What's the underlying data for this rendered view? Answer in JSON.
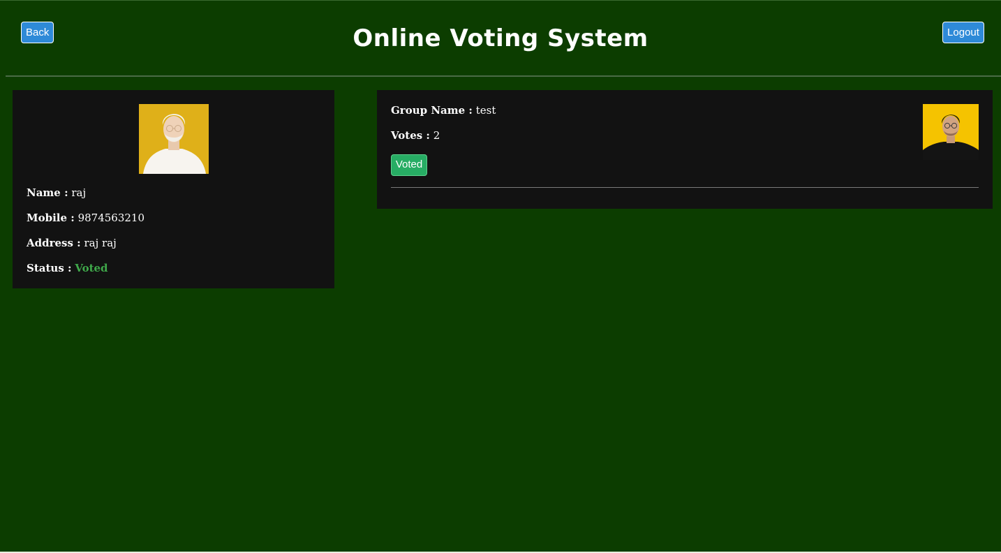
{
  "header": {
    "title": "Online Voting System",
    "back_label": "Back",
    "logout_label": "Logout"
  },
  "profile": {
    "name_label": "Name :",
    "name": "raj",
    "mobile_label": "Mobile :",
    "mobile": "9874563210",
    "address_label": "Address :",
    "address": "raj raj",
    "status_label": "Status :",
    "status": "Voted"
  },
  "groups": [
    {
      "group_name_label": "Group Name :",
      "group_name": "test",
      "votes_label": "Votes :",
      "votes": "2",
      "vote_button_label": "Voted"
    }
  ],
  "colors": {
    "background": "#0c3d00",
    "card": "#121212",
    "button_blue": "#2e8ad8",
    "button_green": "#27ad64",
    "status_green": "#3fa84a"
  }
}
